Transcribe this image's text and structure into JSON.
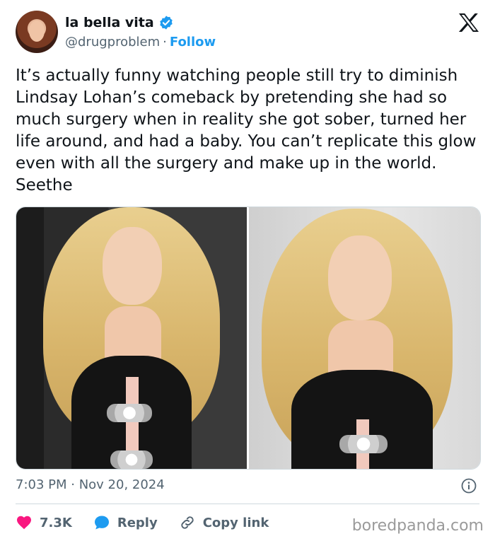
{
  "author": {
    "display_name": "la bella vita",
    "handle": "@drugproblem",
    "separator": "·",
    "follow_label": "Follow"
  },
  "tweet": {
    "text": "It’s actually funny watching people still try to diminish Lindsay Lohan’s comeback by pretending she had so much surgery when in reality she got sober, turned her life around, and had a baby. You can’t replicate this glow even with all the surgery and make up in the world. Seethe",
    "timestamp": "7:03 PM · Nov 20, 2024"
  },
  "actions": {
    "like_count": "7.3K",
    "reply_label": "Reply",
    "copy_link_label": "Copy link"
  },
  "watermark": "boredpanda.com",
  "colors": {
    "accent": "#1d9bf0",
    "like": "#f91880",
    "text": "#0f1419",
    "secondary": "#536471"
  },
  "icons": [
    "verified-badge-icon",
    "x-logo-icon",
    "info-icon",
    "heart-icon",
    "reply-bubble-icon",
    "link-icon"
  ]
}
